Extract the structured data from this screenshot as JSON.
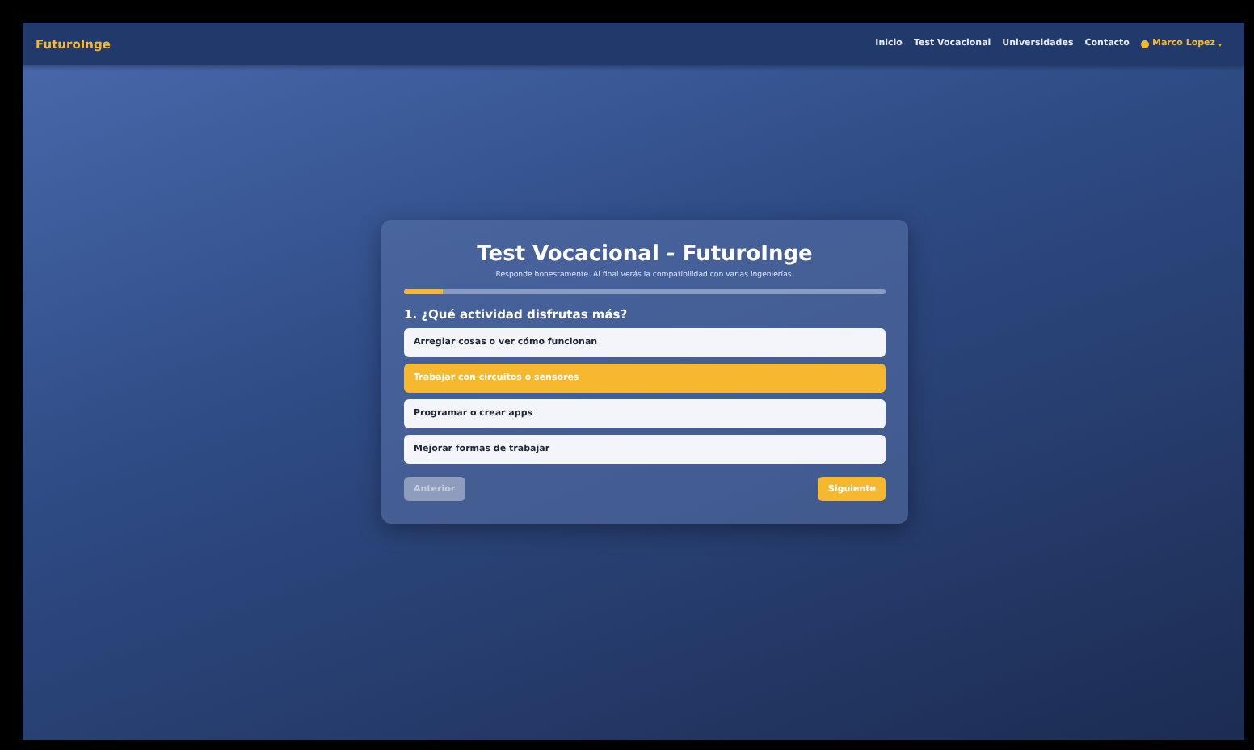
{
  "navbar": {
    "brand": "FuturoInge",
    "links": [
      "Inicio",
      "Test Vocacional",
      "Universidades",
      "Contacto"
    ],
    "user": {
      "name": "Marco Lopez",
      "caret": "▾"
    }
  },
  "quiz": {
    "title": "Test Vocacional - FuturoInge",
    "subtitle": "Responde honestamente. Al final verás la compatibilidad con varias ingenierías.",
    "progress": {
      "level": 0.08
    },
    "question": "1. ¿Qué actividad disfrutas más?",
    "options": [
      {
        "label": "Arreglar cosas o ver cómo funcionan",
        "selected": false
      },
      {
        "label": "Trabajar con circuitos o sensores",
        "selected": true
      },
      {
        "label": "Programar o crear apps",
        "selected": false
      },
      {
        "label": "Mejorar formas de trabajar",
        "selected": false
      }
    ],
    "buttons": {
      "previous": {
        "label": "Anterior",
        "disabled": true
      },
      "next": {
        "label": "Siguiente",
        "disabled": false
      }
    }
  }
}
